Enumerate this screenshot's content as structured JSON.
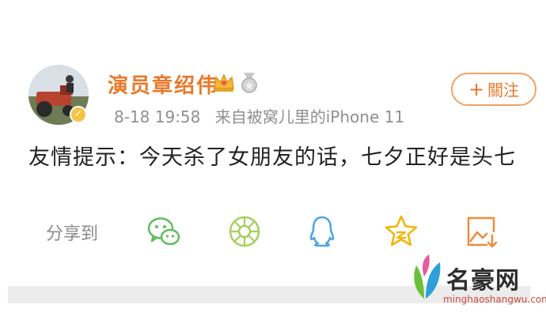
{
  "post": {
    "author": {
      "name": "演员章绍伟",
      "badges": [
        "crown-badge-icon",
        "medal-badge-icon"
      ],
      "verified_icon": "verified-v-icon"
    },
    "time": "8-18 19:58",
    "source": "来自被窝儿里的iPhone 11",
    "follow": {
      "plus": "+",
      "label": "關注"
    },
    "content": "友情提示：今天杀了女朋友的话，七夕正好是头七"
  },
  "share": {
    "label": "分享到",
    "targets": [
      "wechat-icon",
      "moments-icon",
      "qq-icon",
      "qzone-icon",
      "save-image-icon"
    ]
  },
  "watermark": {
    "title": "名豪网",
    "url": "minghaoshangwu.com"
  },
  "colors": {
    "accent": "#e8792a",
    "wechat": "#5cbf5c",
    "qq": "#4ca3e8",
    "qzone": "#f4b400"
  }
}
